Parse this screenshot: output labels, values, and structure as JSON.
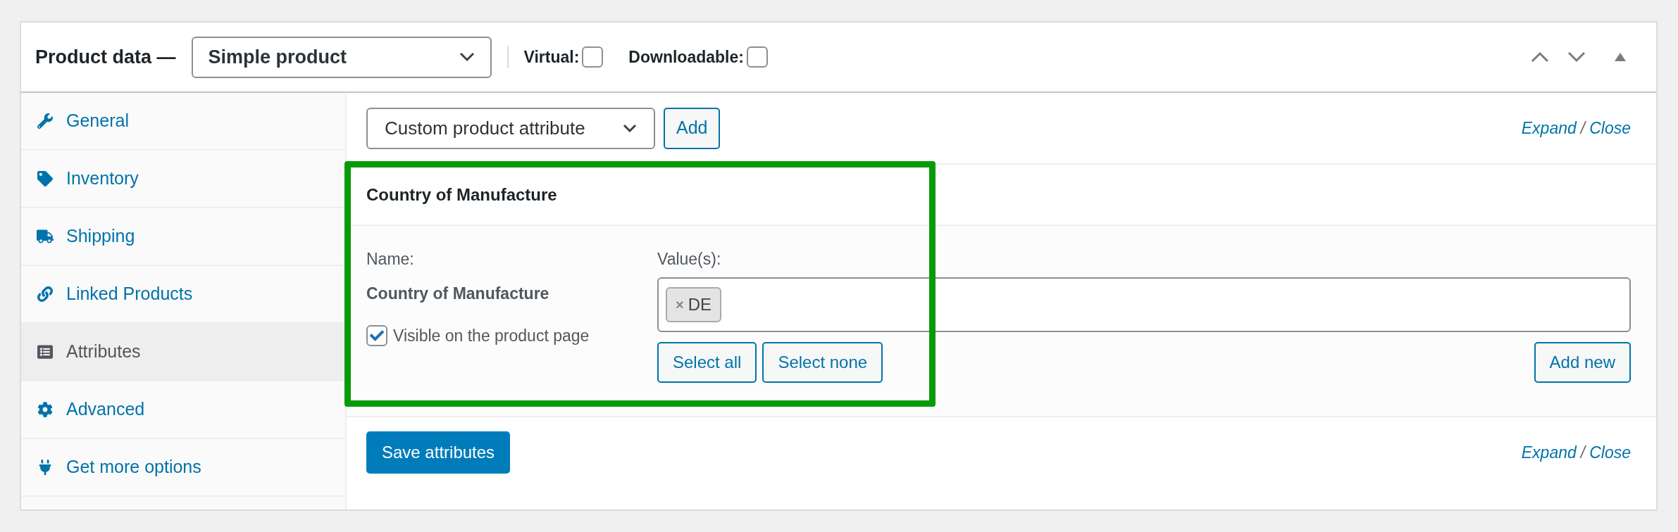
{
  "header": {
    "title": "Product data —",
    "product_type": "Simple product",
    "options": [
      {
        "label": "Virtual:",
        "checked": false
      },
      {
        "label": "Downloadable:",
        "checked": false
      }
    ]
  },
  "sidebar": {
    "items": [
      {
        "label": "General",
        "kind": "wrench",
        "selected": false
      },
      {
        "label": "Inventory",
        "kind": "tag",
        "selected": false
      },
      {
        "label": "Shipping",
        "kind": "truck",
        "selected": false
      },
      {
        "label": "Linked Products",
        "kind": "link",
        "selected": false
      },
      {
        "label": "Attributes",
        "kind": "list",
        "selected": true
      },
      {
        "label": "Advanced",
        "kind": "gear",
        "selected": false
      },
      {
        "label": "Get more options",
        "kind": "plug",
        "selected": false
      }
    ]
  },
  "toolbar": {
    "attribute_select": "Custom product attribute",
    "add_button": "Add",
    "expand": "Expand",
    "separator": "/",
    "close": "Close"
  },
  "attributes": [
    {
      "title": "Country of Manufacture",
      "name_label": "Name:",
      "name": "Country of Manufacture",
      "visible": {
        "label": "Visible on the product page",
        "checked": true
      },
      "values_label": "Value(s):",
      "values": [
        {
          "label": "DE",
          "remove": "×"
        }
      ],
      "buttons": [
        "Select all",
        "Select none"
      ],
      "add_new": "Add new",
      "highlighted": true
    }
  ],
  "footer": {
    "save_button": "Save attributes",
    "expand": "Expand",
    "separator": "/",
    "close": "Close"
  }
}
